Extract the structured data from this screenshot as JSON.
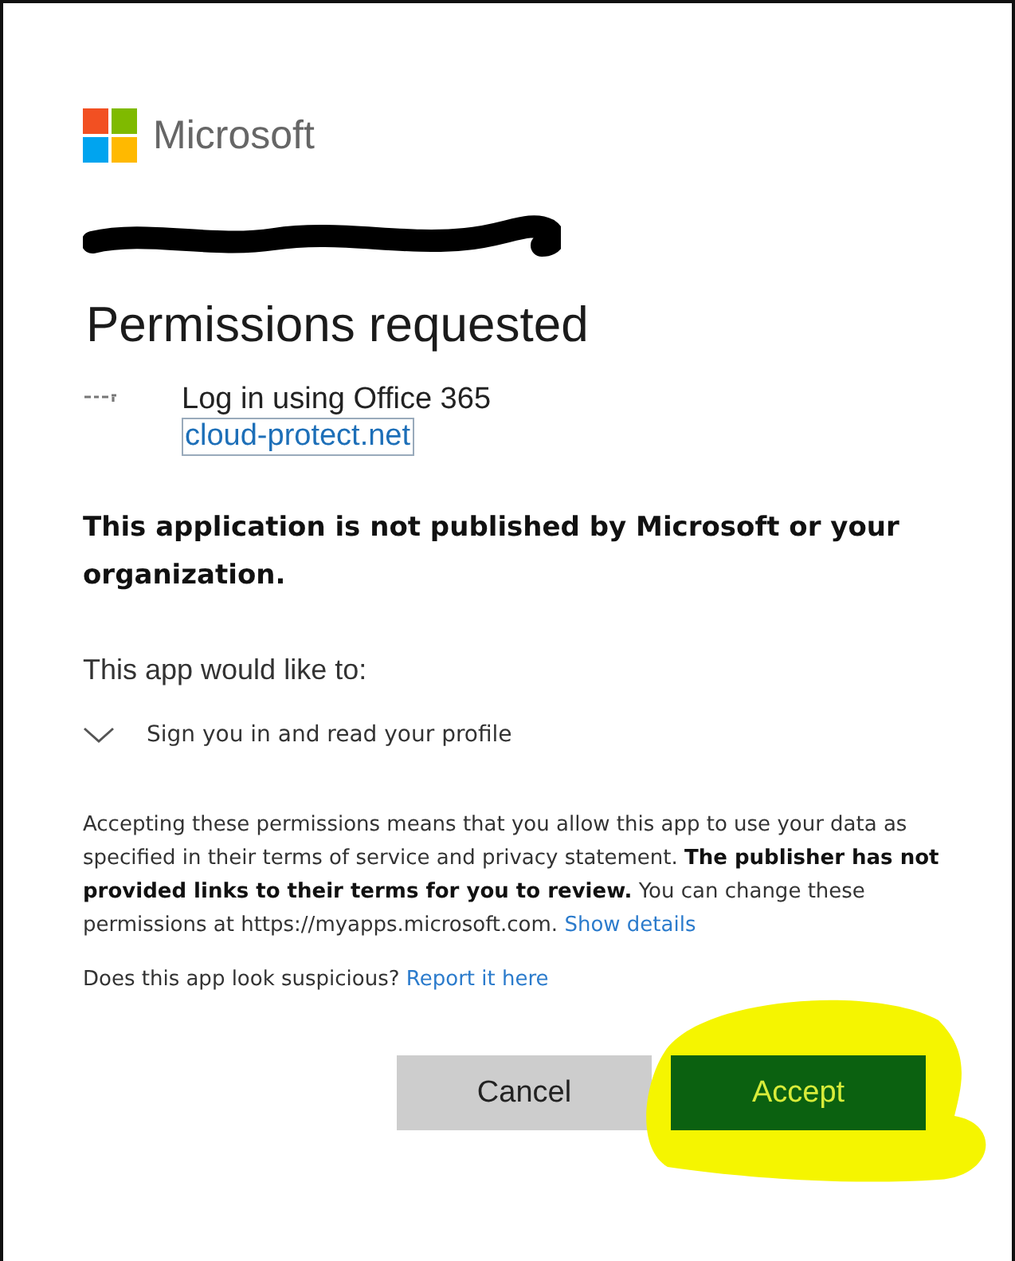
{
  "brand": {
    "name": "Microsoft"
  },
  "title": "Permissions requested",
  "app": {
    "name": "Log in using Office 365",
    "publisher_link": "cloud-protect.net"
  },
  "warning": "This application is not published by Microsoft or your organization.",
  "intro": "This app would like to:",
  "permissions": [
    {
      "label": "Sign you in and read your profile",
      "expanded": false
    }
  ],
  "notice": {
    "text": "Accepting these permissions means that you allow this app to use your data as specified in their terms of service and privacy statement. **The publisher has not provided links to their terms for you to review.** You can change these permissions at https://myapps.microsoft.com.",
    "link": "Show details"
  },
  "report": {
    "question": "Does this app look suspicious?",
    "link": "Report it here"
  },
  "buttons": [
    {
      "label": "Cancel",
      "kind": "secondary",
      "highlighted": false
    },
    {
      "label": "Accept",
      "kind": "primary",
      "highlighted": true
    }
  ]
}
